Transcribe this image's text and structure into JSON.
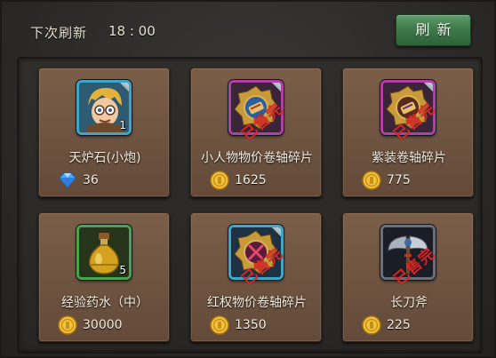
{
  "header": {
    "refresh_label": "下次刷新",
    "refresh_time": "18 : 00",
    "refresh_button": "刷新"
  },
  "stamp_text": "已售完",
  "items": [
    {
      "name": "天炉石(小炮)",
      "quantity": "1",
      "currency": "diamond",
      "price": "36",
      "frame": "blue",
      "sold_out": false,
      "icon": "hero-portrait-icon"
    },
    {
      "name": "小人物物价卷轴碎片",
      "quantity": "",
      "currency": "gold",
      "price": "1625",
      "frame": "purple",
      "sold_out": true,
      "icon": "scroll-fragment-icon"
    },
    {
      "name": "紫装卷轴碎片",
      "quantity": "",
      "currency": "gold",
      "price": "775",
      "frame": "purple",
      "sold_out": true,
      "icon": "scroll-fragment-icon"
    },
    {
      "name": "经验药水（中）",
      "quantity": "5",
      "currency": "gold",
      "price": "30000",
      "frame": "green",
      "sold_out": false,
      "icon": "potion-icon"
    },
    {
      "name": "红权物价卷轴碎片",
      "quantity": "",
      "currency": "gold",
      "price": "1350",
      "frame": "blue",
      "sold_out": true,
      "icon": "scroll-fragment-icon"
    },
    {
      "name": "长刀斧",
      "quantity": "",
      "currency": "gold",
      "price": "225",
      "frame": "dark",
      "sold_out": true,
      "icon": "axe-icon"
    }
  ],
  "colors": {
    "card": "#6f5441",
    "button": "#3f7a4b",
    "stamp": "#e02a2a"
  }
}
